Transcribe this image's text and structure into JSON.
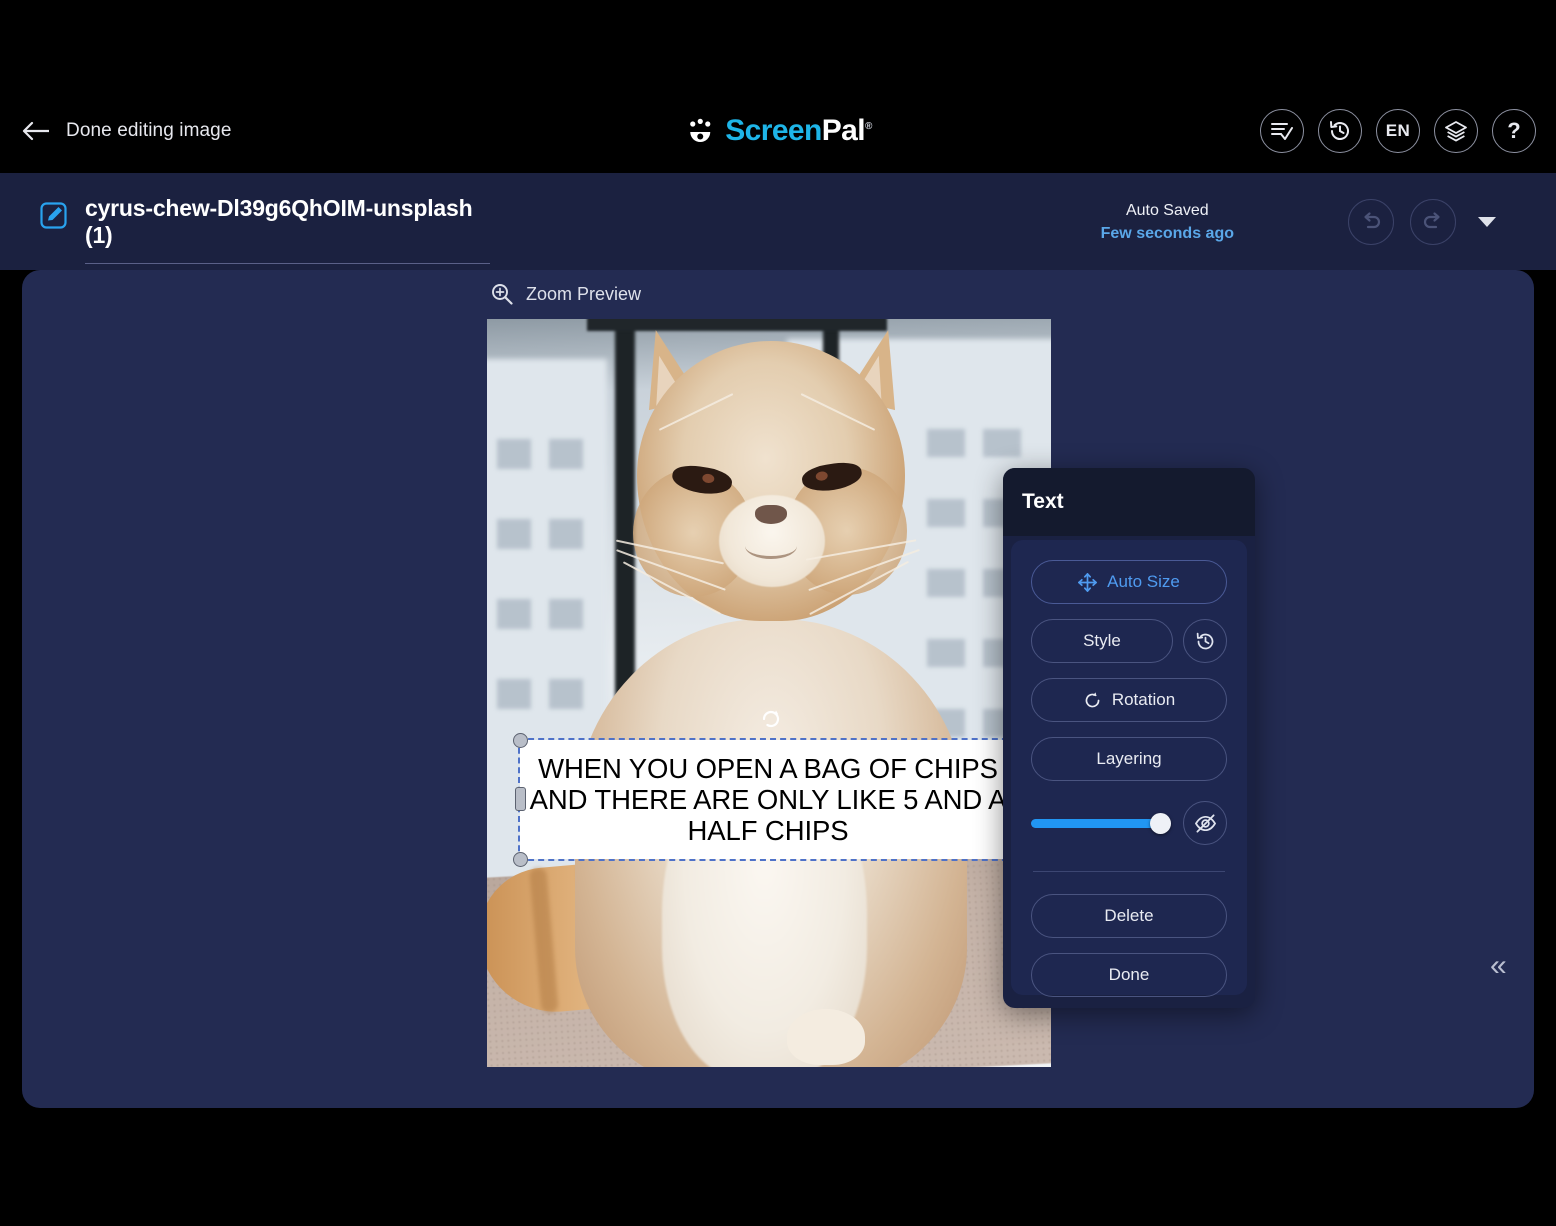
{
  "topbar": {
    "back_label": "Done editing image",
    "back_icon": "arrow-left-icon",
    "brand": {
      "part1": "Screen",
      "part2": "Pal",
      "registered": "®"
    },
    "icons": [
      {
        "name": "checklist-icon",
        "label": ""
      },
      {
        "name": "history-icon",
        "label": ""
      },
      {
        "name": "language-icon",
        "label": "EN"
      },
      {
        "name": "layers-icon",
        "label": ""
      },
      {
        "name": "help-icon",
        "label": "?"
      }
    ]
  },
  "filerow": {
    "edit_icon": "edit-square-icon",
    "filename": "cyrus-chew-Dl39g6QhOIM-unsplash (1)",
    "save_status": "Auto Saved",
    "save_time": "Few seconds ago",
    "undo_icon": "undo-icon",
    "redo_icon": "redo-icon",
    "more_icon": "caret-down-icon"
  },
  "canvas": {
    "zoom_preview_label": "Zoom Preview",
    "zoom_preview_icon": "magnifier-plus-icon",
    "collapse_icon": "double-chevron-left-icon",
    "image_alt": "grumpy exotic shorthair cat sitting on carpet by a window"
  },
  "text_object": {
    "content": "WHEN YOU OPEN A BAG OF CHIPS\nAND THERE ARE ONLY LIKE 5 AND A\nHALF CHIPS",
    "background": "#ffffff",
    "color": "#000000",
    "selection_color": "#4f72c8"
  },
  "text_panel": {
    "title": "Text",
    "auto_size": {
      "label": "Auto Size",
      "icon": "move-arrows-icon"
    },
    "style": {
      "label": "Style",
      "reset_icon": "history-icon"
    },
    "rotation": {
      "label": "Rotation",
      "icon": "rotate-cw-icon"
    },
    "layering": {
      "label": "Layering"
    },
    "opacity": {
      "value": 92,
      "visibility_icon": "eye-off-icon",
      "accent": "#2196f3"
    },
    "delete": {
      "label": "Delete"
    },
    "done": {
      "label": "Done"
    }
  }
}
